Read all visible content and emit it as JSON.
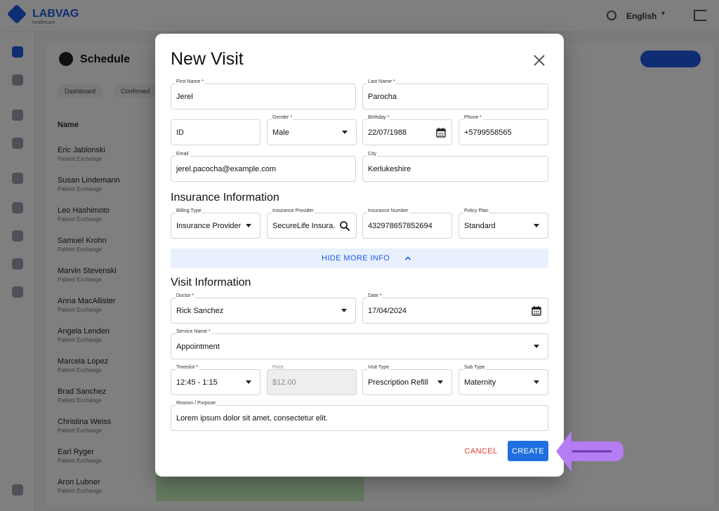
{
  "background": {
    "brand": "LABVAG",
    "brand_sub": "healthcare",
    "language": "English",
    "page_title": "Schedule",
    "filters": [
      "Dashboard",
      "Confirmed"
    ],
    "table_header": "Name",
    "rows": [
      {
        "name": "Eric Jablonski",
        "sub": "Patient Exchange"
      },
      {
        "name": "Susan Lindemann",
        "sub": "Patient Exchange"
      },
      {
        "name": "Leo Hashimoto",
        "sub": "Patient Exchange"
      },
      {
        "name": "Samuel Krohn",
        "sub": "Patient Exchange"
      },
      {
        "name": "Marvin Stevenski",
        "sub": "Patient Exchange"
      },
      {
        "name": "Anna MacAllister",
        "sub": "Patient Exchange"
      },
      {
        "name": "Angela Lenden",
        "sub": "Patient Exchange"
      },
      {
        "name": "Marcela Lopez",
        "sub": "Patient Exchange"
      },
      {
        "name": "Brad Sanchez",
        "sub": "Patient Exchange"
      },
      {
        "name": "Christina Weiss",
        "sub": "Patient Exchange"
      },
      {
        "name": "Earl Ryger",
        "sub": "Patient Exchange"
      },
      {
        "name": "Aron Lubner",
        "sub": "Patient Exchange"
      }
    ]
  },
  "modal": {
    "title": "New Visit",
    "patient": {
      "first_name": {
        "label": "First Name *",
        "value": "Jerel"
      },
      "last_name": {
        "label": "Last Name *",
        "value": "Parocha"
      },
      "id": {
        "label": "",
        "value": "ID"
      },
      "gender": {
        "label": "Gender *",
        "value": "Male"
      },
      "birthday": {
        "label": "Birthday *",
        "value": "22/07/1988"
      },
      "phone": {
        "label": "Phone *",
        "value": "+5799558565"
      },
      "email": {
        "label": "Email",
        "value": "jerel.pacocha@example.com"
      },
      "city": {
        "label": "City",
        "value": "Kerlukeshire"
      }
    },
    "insurance_title": "Insurance Information",
    "insurance": {
      "billing_type": {
        "label": "Billing Type",
        "value": "Insurance Provider"
      },
      "provider": {
        "label": "Insurance Provider",
        "value": "SecureLife Insura..."
      },
      "number": {
        "label": "Insurance Number",
        "value": "432978657852694"
      },
      "policy_plan": {
        "label": "Policy Plan",
        "value": "Standard"
      }
    },
    "hide_more_info": "HIDE MORE INFO",
    "visit_title": "Visit Information",
    "visit": {
      "doctor": {
        "label": "Doctor *",
        "value": "Rick Sanchez"
      },
      "date": {
        "label": "Date *",
        "value": "17/04/2024"
      },
      "service": {
        "label": "Service Name *",
        "value": "Appointment"
      },
      "timeslot": {
        "label": "Timeslot *",
        "value": "12:45 - 1:15"
      },
      "price": {
        "label": "Price",
        "value": "$12.00"
      },
      "visit_type": {
        "label": "Visit Type",
        "value": "Prescription Refill"
      },
      "sub_type": {
        "label": "Sub Type",
        "value": "Maternity"
      },
      "reason": {
        "label": "Reason / Purpose",
        "value": "Lorem ipsum dolor sit amet, consectetur elit."
      }
    },
    "cancel": "CANCEL",
    "create": "CREATE"
  },
  "colors": {
    "accent": "#1f6fe0",
    "cancel": "#e53935",
    "annotation_arrow": "#b57cf4"
  }
}
